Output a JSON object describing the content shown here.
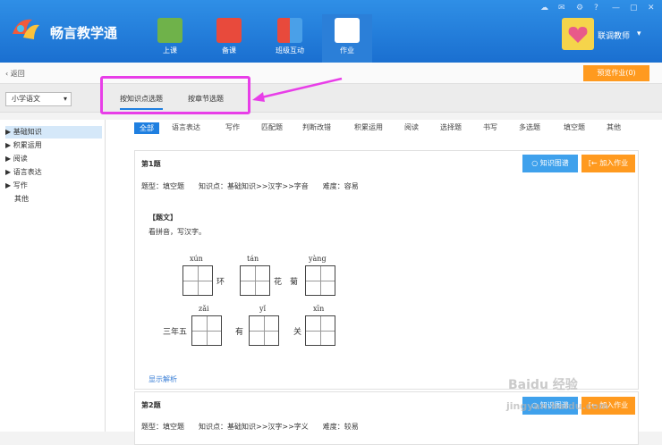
{
  "app": {
    "name": "畅言教学通"
  },
  "nav": [
    {
      "label": "上课",
      "color": "#6fb24a"
    },
    {
      "label": "备课",
      "color": "#e84a3c"
    },
    {
      "label": "班级互动",
      "color": "#4aa0e8"
    },
    {
      "label": "作业",
      "color": "#ffffff"
    }
  ],
  "user": {
    "name": "联调教师"
  },
  "backbar": {
    "back_label": "返回",
    "preview_label": "预览作业(0)"
  },
  "subject": {
    "value": "小学语文"
  },
  "tabs": [
    "按知识点选题",
    "按章节选题"
  ],
  "sidebar": [
    {
      "label": "基础知识",
      "arrow": "▶"
    },
    {
      "label": "积累运用",
      "arrow": "▶"
    },
    {
      "label": "阅读",
      "arrow": "▶"
    },
    {
      "label": "语言表达",
      "arrow": "▶"
    },
    {
      "label": "写作",
      "arrow": "▶"
    },
    {
      "label": "其他",
      "arrow": ""
    }
  ],
  "filters": [
    "全部",
    "语言表达",
    "写作",
    "匹配题",
    "判断改错",
    "积累运用",
    "阅读",
    "选择题",
    "书写",
    "多选题",
    "填空题",
    "其他"
  ],
  "q1": {
    "title": "第1题",
    "meta": "题型：填空题　　知识点：基础知识>>汉字>>字音　　难度：容易",
    "stem_label": "【题文】",
    "instruction": "看拼音，写汉字。",
    "btn_knowledge": "知识图谱",
    "btn_add": "加入作业",
    "row1": [
      {
        "py": "xún",
        "pre": "",
        "post": "环"
      },
      {
        "py": "tán",
        "pre": "",
        "post": "花　菊"
      },
      {
        "py": "yàng",
        "pre": "",
        "post": ""
      }
    ],
    "row2": [
      {
        "py": "zǎi",
        "pre": "三年五",
        "post": ""
      },
      {
        "py": "yǐ",
        "pre": "有",
        "post": ""
      },
      {
        "py": "xīn",
        "pre": "",
        "post": "关"
      }
    ],
    "show_analysis": "显示解析"
  },
  "q2": {
    "title": "第2题",
    "meta": "题型：填空题　　知识点：基础知识>>汉字>>字义　　难度：较易",
    "btn_knowledge": "知识图谱",
    "btn_add": "加入作业"
  },
  "watermark": {
    "line1": "Baidu 经验",
    "line2": "jingyan.baidu.com"
  }
}
